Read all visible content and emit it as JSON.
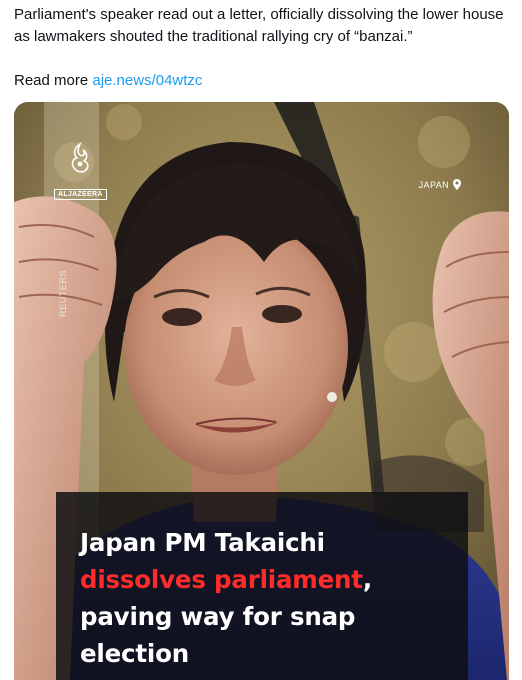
{
  "tweet": {
    "text": "Parliament's speaker read out a letter, officially dissolving the lower house as lawmakers shouted the traditional rallying cry of “banzai.”",
    "read_more_label": "Read more",
    "link_text": "aje.news/04wtzc"
  },
  "media": {
    "brand": "ALJAZEERA",
    "location": "JAPAN",
    "photo_credit": "REUTERS",
    "headline": {
      "line1": "Japan PM Takaichi",
      "highlight": "dissolves parliament",
      "after_highlight": ",",
      "rest": "paving way for snap election"
    }
  },
  "colors": {
    "link": "#1d9bf0",
    "headline_accent": "#ff2b2b",
    "headline_text": "#ffffff"
  },
  "icons": {
    "brand_logo": "aljazeera-logo-icon",
    "location_pin": "location-pin-icon"
  }
}
